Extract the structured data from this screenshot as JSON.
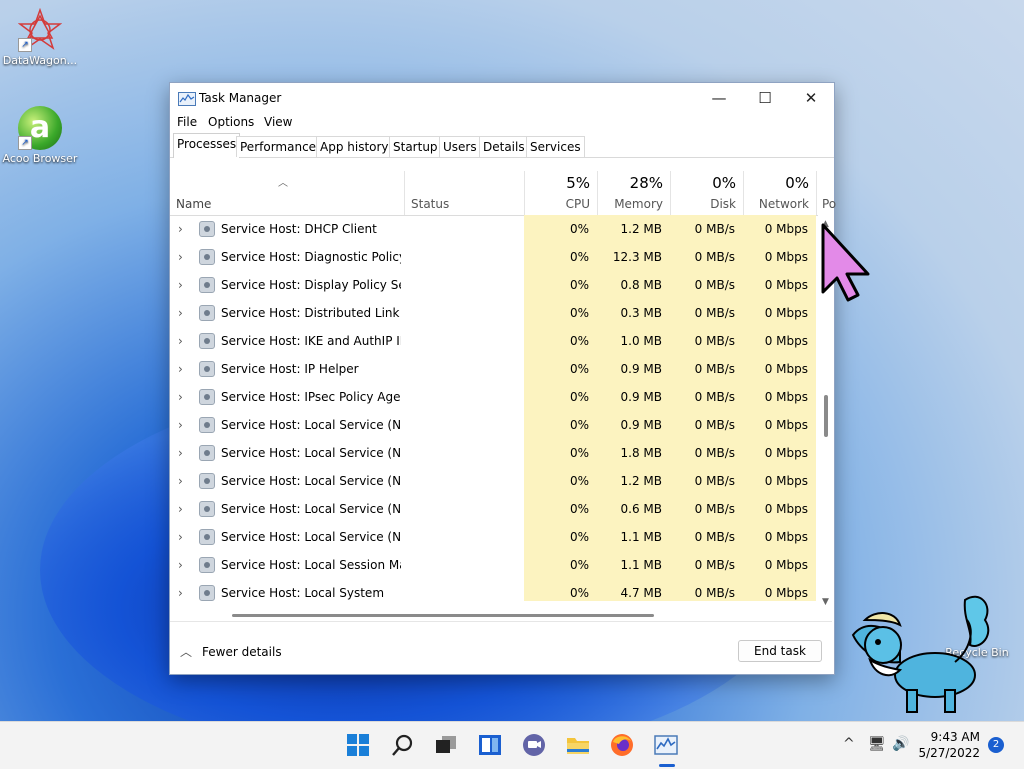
{
  "desktop": {
    "icons": [
      {
        "label": "DataWagon..."
      },
      {
        "label": "Acoo Browser"
      },
      {
        "label": "Recycle Bin"
      }
    ]
  },
  "window": {
    "title": "Task Manager",
    "controls": {
      "minimize": "—",
      "maximize": "☐",
      "close": "✕"
    },
    "menu": [
      "File",
      "Options",
      "View"
    ],
    "tabs": [
      "Processes",
      "Performance",
      "App history",
      "Startup",
      "Users",
      "Details",
      "Services"
    ],
    "active_tab": "Processes",
    "columns": {
      "name": "Name",
      "status": "Status",
      "cpu": {
        "pct": "5%",
        "label": "CPU"
      },
      "memory": {
        "pct": "28%",
        "label": "Memory"
      },
      "disk": {
        "pct": "0%",
        "label": "Disk"
      },
      "network": {
        "pct": "0%",
        "label": "Network"
      },
      "power": "Po"
    },
    "rows": [
      {
        "name": "Service Host: DHCP Client",
        "cpu": "0%",
        "memory": "1.2 MB",
        "disk": "0 MB/s",
        "network": "0 Mbps"
      },
      {
        "name": "Service Host: Diagnostic Policy ...",
        "cpu": "0%",
        "memory": "12.3 MB",
        "disk": "0 MB/s",
        "network": "0 Mbps"
      },
      {
        "name": "Service Host: Display Policy Serv...",
        "cpu": "0%",
        "memory": "0.8 MB",
        "disk": "0 MB/s",
        "network": "0 Mbps"
      },
      {
        "name": "Service Host: Distributed Link Tr...",
        "cpu": "0%",
        "memory": "0.3 MB",
        "disk": "0 MB/s",
        "network": "0 Mbps"
      },
      {
        "name": "Service Host: IKE and AuthIP IPs...",
        "cpu": "0%",
        "memory": "1.0 MB",
        "disk": "0 MB/s",
        "network": "0 Mbps"
      },
      {
        "name": "Service Host: IP Helper",
        "cpu": "0%",
        "memory": "0.9 MB",
        "disk": "0 MB/s",
        "network": "0 Mbps"
      },
      {
        "name": "Service Host: IPsec Policy Agent",
        "cpu": "0%",
        "memory": "0.9 MB",
        "disk": "0 MB/s",
        "network": "0 Mbps"
      },
      {
        "name": "Service Host: Local Service (Net...",
        "cpu": "0%",
        "memory": "0.9 MB",
        "disk": "0 MB/s",
        "network": "0 Mbps"
      },
      {
        "name": "Service Host: Local Service (Net...",
        "cpu": "0%",
        "memory": "1.8 MB",
        "disk": "0 MB/s",
        "network": "0 Mbps"
      },
      {
        "name": "Service Host: Local Service (Net...",
        "cpu": "0%",
        "memory": "1.2 MB",
        "disk": "0 MB/s",
        "network": "0 Mbps"
      },
      {
        "name": "Service Host: Local Service (Net...",
        "cpu": "0%",
        "memory": "0.6 MB",
        "disk": "0 MB/s",
        "network": "0 Mbps"
      },
      {
        "name": "Service Host: Local Service (No ...",
        "cpu": "0%",
        "memory": "1.1 MB",
        "disk": "0 MB/s",
        "network": "0 Mbps"
      },
      {
        "name": "Service Host: Local Session Man...",
        "cpu": "0%",
        "memory": "1.1 MB",
        "disk": "0 MB/s",
        "network": "0 Mbps"
      },
      {
        "name": "Service Host: Local System",
        "cpu": "0%",
        "memory": "4.7 MB",
        "disk": "0 MB/s",
        "network": "0 Mbps"
      }
    ],
    "footer": {
      "fewer_details": "Fewer details",
      "end_task": "End task"
    }
  },
  "taskbar": {
    "icons": [
      "windows-start-icon",
      "search-icon",
      "task-view-icon",
      "widgets-icon",
      "chat-icon",
      "file-explorer-icon",
      "firefox-icon",
      "task-manager-icon"
    ],
    "tray": {
      "chevron": "^",
      "network": "🖥",
      "volume": "🔊"
    },
    "clock": {
      "time": "9:43 AM",
      "date": "5/27/2022"
    },
    "notification_count": "2"
  },
  "colors": {
    "heat": "#fcf3c0",
    "accent": "#1a5fd0",
    "cursor": "#e38ae8"
  }
}
